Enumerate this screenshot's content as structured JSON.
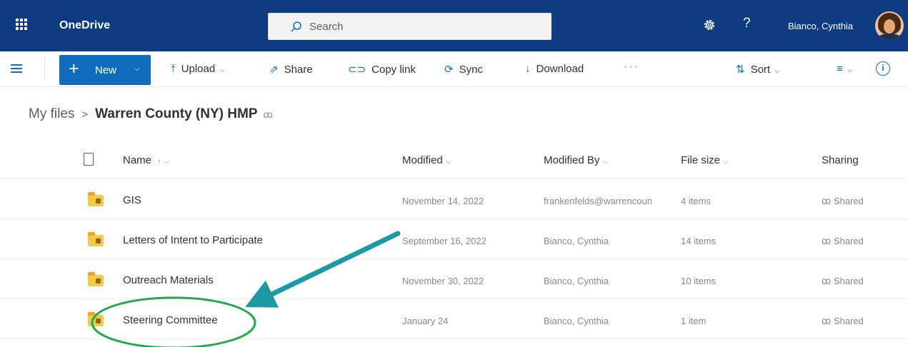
{
  "suite_bar": {
    "app_name": "OneDrive",
    "search_placeholder": "Search",
    "user_name": "Bianco, Cynthia",
    "help_glyph": "?",
    "icons": [
      "app-launcher-icon",
      "search-icon",
      "settings-gear-icon",
      "help-icon",
      "user-avatar"
    ]
  },
  "command_bar": {
    "new_label": "New",
    "upload_label": "Upload",
    "share_label": "Share",
    "copy_link_label": "Copy link",
    "sync_label": "Sync",
    "download_label": "Download",
    "more_label": "···",
    "sort_label": "Sort",
    "info_glyph": "i"
  },
  "breadcrumb": {
    "root": "My files",
    "separator": ">",
    "current": "Warren County (NY) HMP"
  },
  "file_list": {
    "columns": {
      "name": "Name",
      "name_sort_glyph": "↑",
      "modified": "Modified",
      "modified_by": "Modified By",
      "file_size": "File size",
      "sharing": "Sharing"
    },
    "rows": [
      {
        "name": "GIS",
        "modified": "November 14, 2022",
        "modified_by": "frankenfelds@warrencoun",
        "file_size": "4 items",
        "sharing": "Shared"
      },
      {
        "name": "Letters of Intent to Participate",
        "modified": "September 16, 2022",
        "modified_by": "Bianco, Cynthia",
        "file_size": "14 items",
        "sharing": "Shared"
      },
      {
        "name": "Outreach Materials",
        "modified": "November 30, 2022",
        "modified_by": "Bianco, Cynthia",
        "file_size": "10 items",
        "sharing": "Shared"
      },
      {
        "name": "Steering Committee",
        "modified": "January 24",
        "modified_by": "Bianco, Cynthia",
        "file_size": "1 item",
        "sharing": "Shared"
      }
    ]
  },
  "annotation": {
    "arrow_color": "#1b9aa6",
    "circle_color": "#22a94a",
    "highlighted_item": "Steering Committee"
  },
  "colors": {
    "suite_bar": "#0f3b80",
    "accent": "#0f6cbd",
    "folder": "#f8c84a"
  }
}
